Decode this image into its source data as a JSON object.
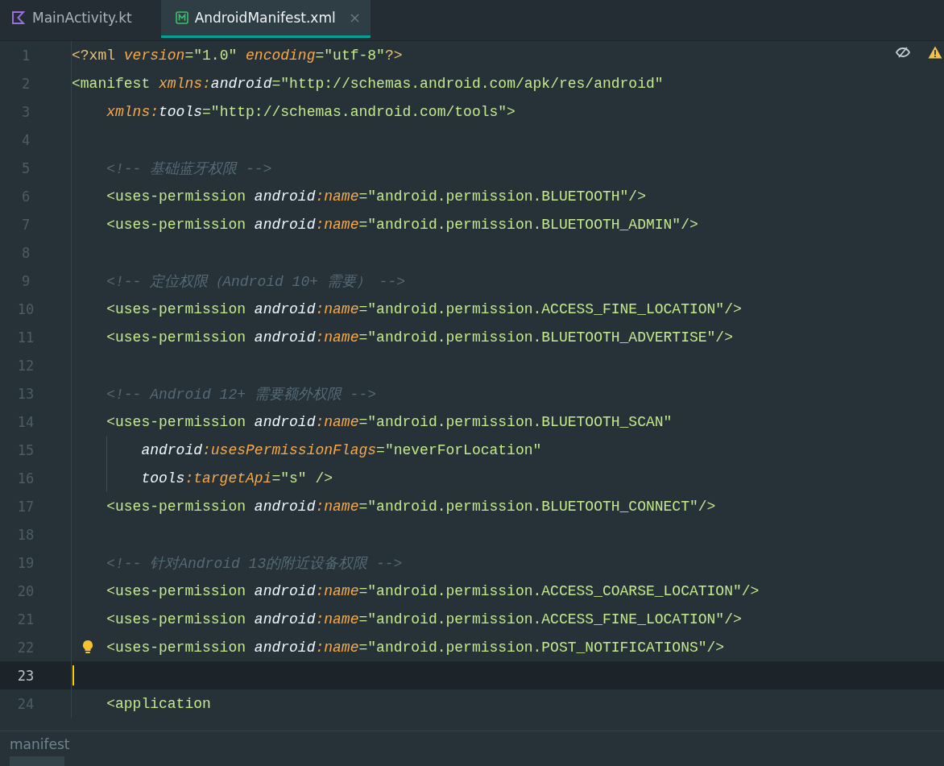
{
  "tabs": [
    {
      "label": "MainActivity.kt",
      "selected": false
    },
    {
      "label": "AndroidManifest.xml",
      "selected": true
    }
  ],
  "lines": [
    {
      "number": "1",
      "current": false,
      "bulb": false,
      "guide": false,
      "tokens": [
        {
          "pi": "<?xml "
        },
        {
          "attr": "version"
        },
        {
          "eq": "="
        },
        {
          "value": "\"1.0\" "
        },
        {
          "attr": "encoding"
        },
        {
          "eq": "="
        },
        {
          "value": "\"utf-8\""
        },
        {
          "pi": "?>"
        }
      ]
    },
    {
      "number": "2",
      "current": false,
      "bulb": false,
      "guide": false,
      "tokens": [
        {
          "tag": "<manifest "
        },
        {
          "attr": "xmlns:"
        },
        {
          "ns": "android"
        },
        {
          "eq": "="
        },
        {
          "value": "\"http://schemas.android.com/apk/res/android\""
        }
      ]
    },
    {
      "number": "3",
      "current": false,
      "bulb": false,
      "guide": false,
      "tokens": [
        {
          "attr": "    xmlns:"
        },
        {
          "ns": "tools"
        },
        {
          "eq": "="
        },
        {
          "value": "\"http://schemas.android.com/tools\""
        },
        {
          "tag": ">"
        }
      ]
    },
    {
      "number": "4",
      "current": false,
      "bulb": false,
      "guide": false
    },
    {
      "number": "5",
      "current": false,
      "bulb": false,
      "guide": false,
      "tokens": [
        {
          "comment": "    <!-- 基础蓝牙权限 -->"
        }
      ]
    },
    {
      "number": "6",
      "current": false,
      "bulb": false,
      "guide": false,
      "tokens": [
        {
          "tag": "    <uses-permission "
        },
        {
          "ns": "android"
        },
        {
          "attr": ":name"
        },
        {
          "eq": "="
        },
        {
          "value": "\"android.permission.BLUETOOTH\""
        },
        {
          "tag": "/>"
        }
      ]
    },
    {
      "number": "7",
      "current": false,
      "bulb": false,
      "guide": false,
      "tokens": [
        {
          "tag": "    <uses-permission "
        },
        {
          "ns": "android"
        },
        {
          "attr": ":name"
        },
        {
          "eq": "="
        },
        {
          "value": "\"android.permission.BLUETOOTH_ADMIN\""
        },
        {
          "tag": "/>"
        }
      ]
    },
    {
      "number": "8",
      "current": false,
      "bulb": false,
      "guide": false
    },
    {
      "number": "9",
      "current": false,
      "bulb": false,
      "guide": false,
      "tokens": [
        {
          "comment": "    <!-- 定位权限（Android 10+ 需要） -->"
        }
      ]
    },
    {
      "number": "10",
      "current": false,
      "bulb": false,
      "guide": false,
      "tokens": [
        {
          "tag": "    <uses-permission "
        },
        {
          "ns": "android"
        },
        {
          "attr": ":name"
        },
        {
          "eq": "="
        },
        {
          "value": "\"android.permission.ACCESS_FINE_LOCATION\""
        },
        {
          "tag": "/>"
        }
      ]
    },
    {
      "number": "11",
      "current": false,
      "bulb": false,
      "guide": false,
      "tokens": [
        {
          "tag": "    <uses-permission "
        },
        {
          "ns": "android"
        },
        {
          "attr": ":name"
        },
        {
          "eq": "="
        },
        {
          "value": "\"android.permission.BLUETOOTH_ADVERTISE\""
        },
        {
          "tag": "/>"
        }
      ]
    },
    {
      "number": "12",
      "current": false,
      "bulb": false,
      "guide": false
    },
    {
      "number": "13",
      "current": false,
      "bulb": false,
      "guide": false,
      "tokens": [
        {
          "comment": "    <!-- Android 12+ 需要额外权限 -->"
        }
      ]
    },
    {
      "number": "14",
      "current": false,
      "bulb": false,
      "guide": false,
      "tokens": [
        {
          "tag": "    <uses-permission "
        },
        {
          "ns": "android"
        },
        {
          "attr": ":name"
        },
        {
          "eq": "="
        },
        {
          "value": "\"android.permission.BLUETOOTH_SCAN\""
        }
      ]
    },
    {
      "number": "15",
      "current": false,
      "bulb": false,
      "guide": true,
      "tokens": [
        {
          "ns": "        android"
        },
        {
          "attr": ":usesPermissionFlags"
        },
        {
          "eq": "="
        },
        {
          "value": "\"neverForLocation\""
        }
      ]
    },
    {
      "number": "16",
      "current": false,
      "bulb": false,
      "guide": true,
      "tokens": [
        {
          "ns": "        tools"
        },
        {
          "attr": ":targetApi"
        },
        {
          "eq": "="
        },
        {
          "value": "\"s\" "
        },
        {
          "tag": "/>"
        }
      ]
    },
    {
      "number": "17",
      "current": false,
      "bulb": false,
      "guide": false,
      "tokens": [
        {
          "tag": "    <uses-permission "
        },
        {
          "ns": "android"
        },
        {
          "attr": ":name"
        },
        {
          "eq": "="
        },
        {
          "value": "\"android.permission.BLUETOOTH_CONNECT\""
        },
        {
          "tag": "/>"
        }
      ]
    },
    {
      "number": "18",
      "current": false,
      "bulb": false,
      "guide": false
    },
    {
      "number": "19",
      "current": false,
      "bulb": false,
      "guide": false,
      "tokens": [
        {
          "comment": "    <!-- 针对Android 13的附近设备权限 -->"
        }
      ]
    },
    {
      "number": "20",
      "current": false,
      "bulb": false,
      "guide": false,
      "tokens": [
        {
          "tag": "    <uses-permission "
        },
        {
          "ns": "android"
        },
        {
          "attr": ":name"
        },
        {
          "eq": "="
        },
        {
          "value": "\"android.permission.ACCESS_COARSE_LOCATION\""
        },
        {
          "tag": "/>"
        }
      ]
    },
    {
      "number": "21",
      "current": false,
      "bulb": false,
      "guide": false,
      "tokens": [
        {
          "tag": "    <uses-permission "
        },
        {
          "ns": "android"
        },
        {
          "attr": ":name"
        },
        {
          "eq": "="
        },
        {
          "value": "\"android.permission.ACCESS_FINE_LOCATION\""
        },
        {
          "tag": "/>"
        }
      ]
    },
    {
      "number": "22",
      "current": false,
      "bulb": true,
      "guide": false,
      "tokens": [
        {
          "tag": "    <uses-permission "
        },
        {
          "ns": "android"
        },
        {
          "attr": ":name"
        },
        {
          "eq": "="
        },
        {
          "value": "\"android.permission.POST_NOTIFICATIONS\""
        },
        {
          "tag": "/>"
        }
      ]
    },
    {
      "number": "23",
      "current": true,
      "bulb": false,
      "guide": false
    },
    {
      "number": "24",
      "current": false,
      "bulb": false,
      "guide": false,
      "tokens": [
        {
          "tag": "    <application"
        }
      ]
    }
  ],
  "breadcrumb": "manifest"
}
